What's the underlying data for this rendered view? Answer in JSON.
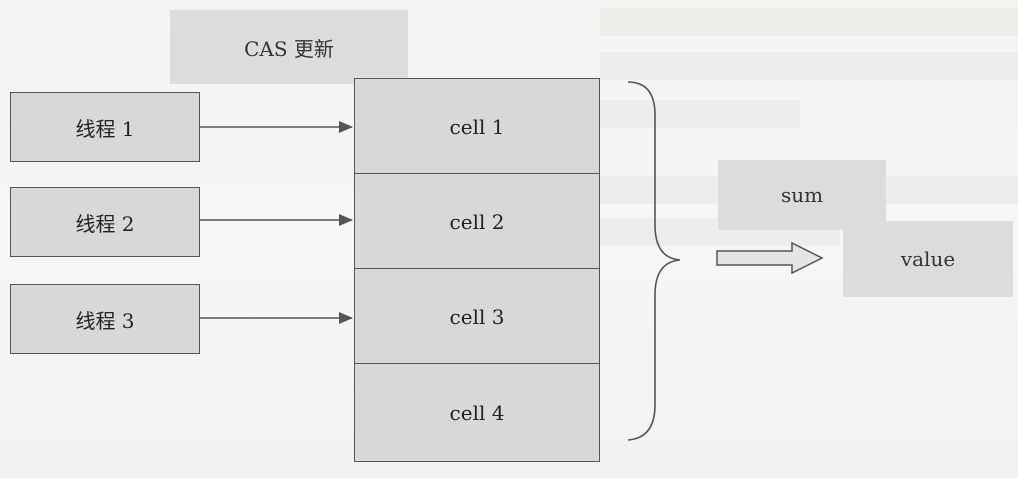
{
  "diagram": {
    "cas_label": "CAS 更新",
    "threads": [
      "线程 1",
      "线程 2",
      "线程 3"
    ],
    "cells": [
      "cell 1",
      "cell 2",
      "cell 3",
      "cell 4"
    ],
    "sum_label": "sum",
    "value_label": "value"
  },
  "colors": {
    "box_fill": "#d8d8d6",
    "stroke": "#555555",
    "label_fill": "#dcdcda"
  }
}
